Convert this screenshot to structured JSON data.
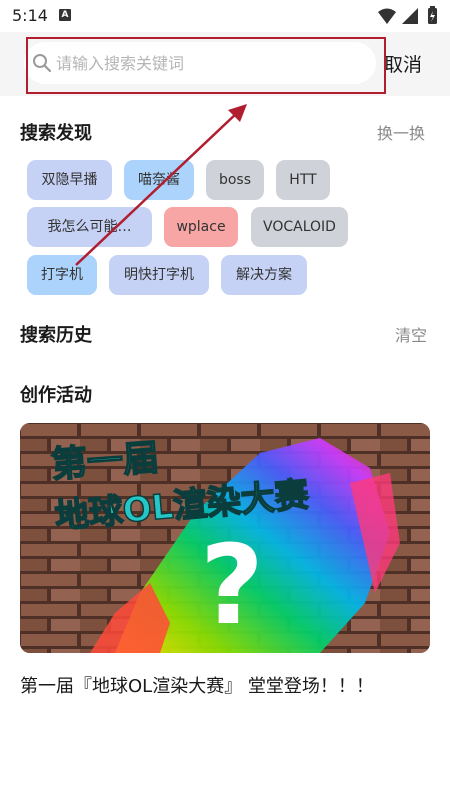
{
  "status_bar": {
    "time": "5:14",
    "notification_glyph": "A",
    "icons": [
      "wifi-icon",
      "signal-icon",
      "battery-icon"
    ]
  },
  "search": {
    "placeholder": "请输入搜索关键词",
    "cancel_label": "取消"
  },
  "discover": {
    "title": "搜索发现",
    "action": "换一换",
    "tags": [
      {
        "label": "双隐早播",
        "style": "purple"
      },
      {
        "label": "喵奈酱",
        "style": "blue"
      },
      {
        "label": "boss",
        "style": "gray"
      },
      {
        "label": "HTT",
        "style": "gray"
      },
      {
        "label": "我怎么可能…",
        "style": "purple"
      },
      {
        "label": "wplace",
        "style": "red"
      },
      {
        "label": "VOCALOID",
        "style": "gray"
      },
      {
        "label": "打字机",
        "style": "blue"
      },
      {
        "label": "明快打字机",
        "style": "purple"
      },
      {
        "label": "解决方案",
        "style": "purple"
      }
    ]
  },
  "history": {
    "title": "搜索历史",
    "action": "清空"
  },
  "events": {
    "title": "创作活动",
    "banner_text": [
      "第一届",
      "地球OL渲染大赛",
      "?"
    ],
    "caption": "第一届『地球OL渲染大赛』 堂堂登场！！！"
  },
  "colors": {
    "annotation": "#b01e2f",
    "tag_purple": "#c5d2f5",
    "tag_blue": "#abd3fb",
    "tag_gray": "#cfd2d8",
    "tag_red": "#f7a5a5"
  }
}
